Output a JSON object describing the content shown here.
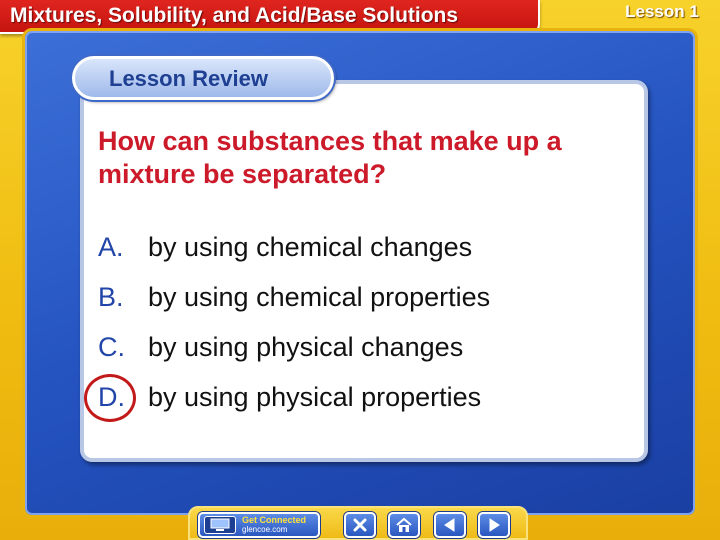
{
  "header": {
    "title": "Mixtures, Solubility, and Acid/Base Solutions",
    "lesson": "Lesson 1"
  },
  "section": {
    "title": "Lesson Review"
  },
  "question": {
    "text": "How can substances that make up a mixture be separated?"
  },
  "answers": [
    {
      "letter": "A.",
      "text": "by using chemical changes"
    },
    {
      "letter": "B.",
      "text": "by using chemical properties"
    },
    {
      "letter": "C.",
      "text": "by using physical changes"
    },
    {
      "letter": "D.",
      "text": "by using physical properties"
    }
  ],
  "correct_answer": "D.",
  "nav": {
    "get_connected_label": "Get Connected",
    "get_connected_url": "glencoe.com",
    "icons": [
      "computer-icon",
      "close-icon",
      "home-icon",
      "previous-arrow-icon",
      "next-arrow-icon"
    ]
  },
  "colors": {
    "banner_red": "#c5140f",
    "panel_blue": "#2453c0",
    "frame_yellow": "#f0bd12",
    "question_red": "#cc1a2a",
    "letter_blue": "#2145a8",
    "circle_red": "#c21a1a"
  }
}
